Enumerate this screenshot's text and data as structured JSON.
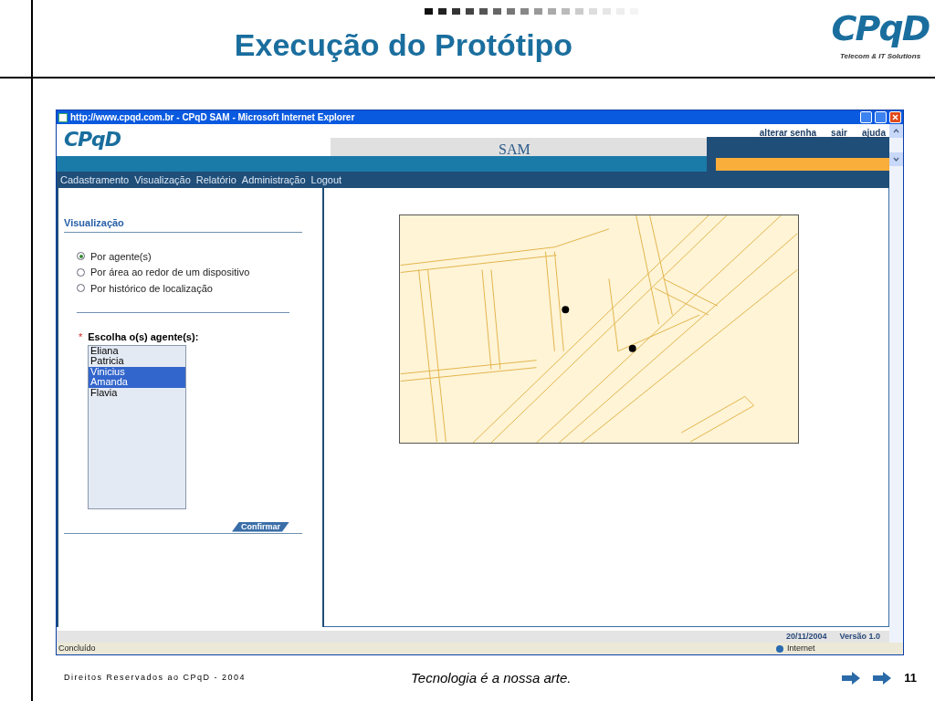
{
  "slide": {
    "title": "Execução do Protótipo",
    "logo": {
      "text": "CPqD",
      "tagline": "Telecom & IT Solutions"
    },
    "footer": {
      "copyright": "Direitos Reservados ao CPqD - 2004",
      "motto": "Tecnologia é a nossa arte.",
      "page": "11"
    }
  },
  "browser": {
    "title": "http://www.cpqd.com.br - CPqD SAM - Microsoft Internet Explorer",
    "header": {
      "logo": "CPqD",
      "app_name": "SAM",
      "links": [
        "alterar senha",
        "sair",
        "ajuda"
      ]
    },
    "menu": [
      "Cadastramento",
      "Visualização",
      "Relatório",
      "Administração",
      "Logout"
    ],
    "panel": {
      "heading": "Visualização",
      "options": [
        {
          "label": "Por agente(s)",
          "selected": true
        },
        {
          "label": "Por área ao redor de um dispositivo",
          "selected": false
        },
        {
          "label": "Por histórico de localização",
          "selected": false
        }
      ],
      "required_mark": "*",
      "list_label": "Escolha o(s) agente(s):",
      "agents": [
        {
          "name": "Eliana",
          "selected": false
        },
        {
          "name": "Patricia",
          "selected": false
        },
        {
          "name": "Vinicius",
          "selected": true
        },
        {
          "name": "Amanda",
          "selected": true
        },
        {
          "name": "Flavia",
          "selected": false
        }
      ],
      "confirm": "Confirmar"
    },
    "footer": {
      "date": "20/11/2004",
      "version": "Versão 1.0"
    },
    "status_bar": {
      "status": "Concluído",
      "zone": "Internet"
    }
  }
}
